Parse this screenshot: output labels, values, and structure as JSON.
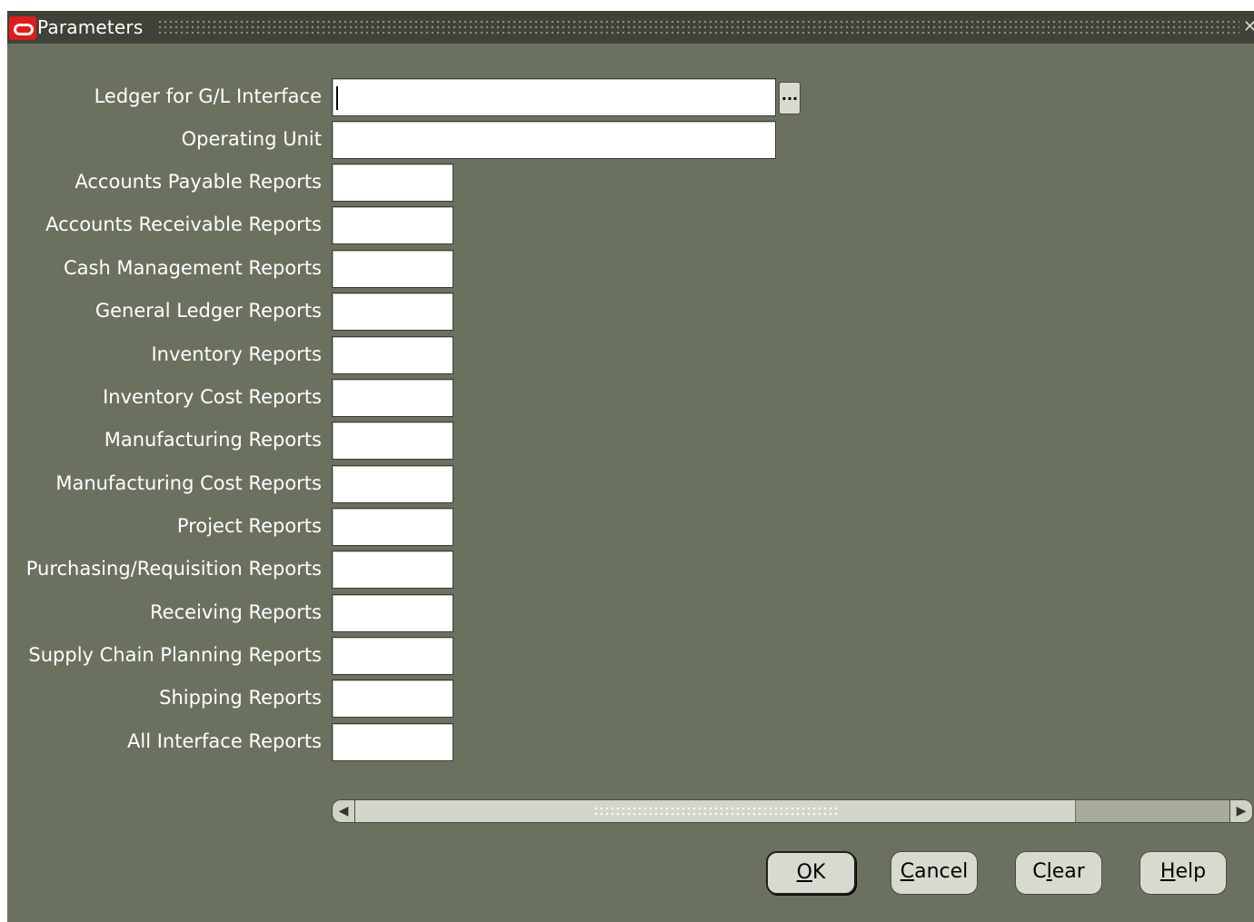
{
  "window": {
    "title": "Parameters",
    "close_icon": "close-icon"
  },
  "fields": [
    {
      "label": "Ledger for G/L Interface",
      "value": ""
    },
    {
      "label": "Operating Unit",
      "value": ""
    },
    {
      "label": "Accounts Payable Reports",
      "value": ""
    },
    {
      "label": "Accounts Receivable Reports",
      "value": ""
    },
    {
      "label": "Cash Management Reports",
      "value": ""
    },
    {
      "label": "General Ledger Reports",
      "value": ""
    },
    {
      "label": "Inventory Reports",
      "value": ""
    },
    {
      "label": "Inventory Cost Reports",
      "value": ""
    },
    {
      "label": "Manufacturing Reports",
      "value": ""
    },
    {
      "label": "Manufacturing Cost Reports",
      "value": ""
    },
    {
      "label": "Project Reports",
      "value": ""
    },
    {
      "label": "Purchasing/Requisition Reports",
      "value": ""
    },
    {
      "label": "Receiving Reports",
      "value": ""
    },
    {
      "label": "Supply Chain Planning Reports",
      "value": ""
    },
    {
      "label": "Shipping Reports",
      "value": ""
    },
    {
      "label": "All Interface Reports",
      "value": ""
    }
  ],
  "lov_button_label": "...",
  "buttons": {
    "ok": {
      "pre": "",
      "accel": "O",
      "post": "K"
    },
    "cancel": {
      "pre": "",
      "accel": "C",
      "post": "ancel"
    },
    "clear": {
      "pre": "C",
      "accel": "l",
      "post": "ear"
    },
    "help": {
      "pre": "",
      "accel": "H",
      "post": "elp"
    }
  },
  "colors": {
    "window_bg": "#6b715f",
    "titlebar_bg": "#3f4238",
    "oracle_red": "#e21b1b"
  }
}
